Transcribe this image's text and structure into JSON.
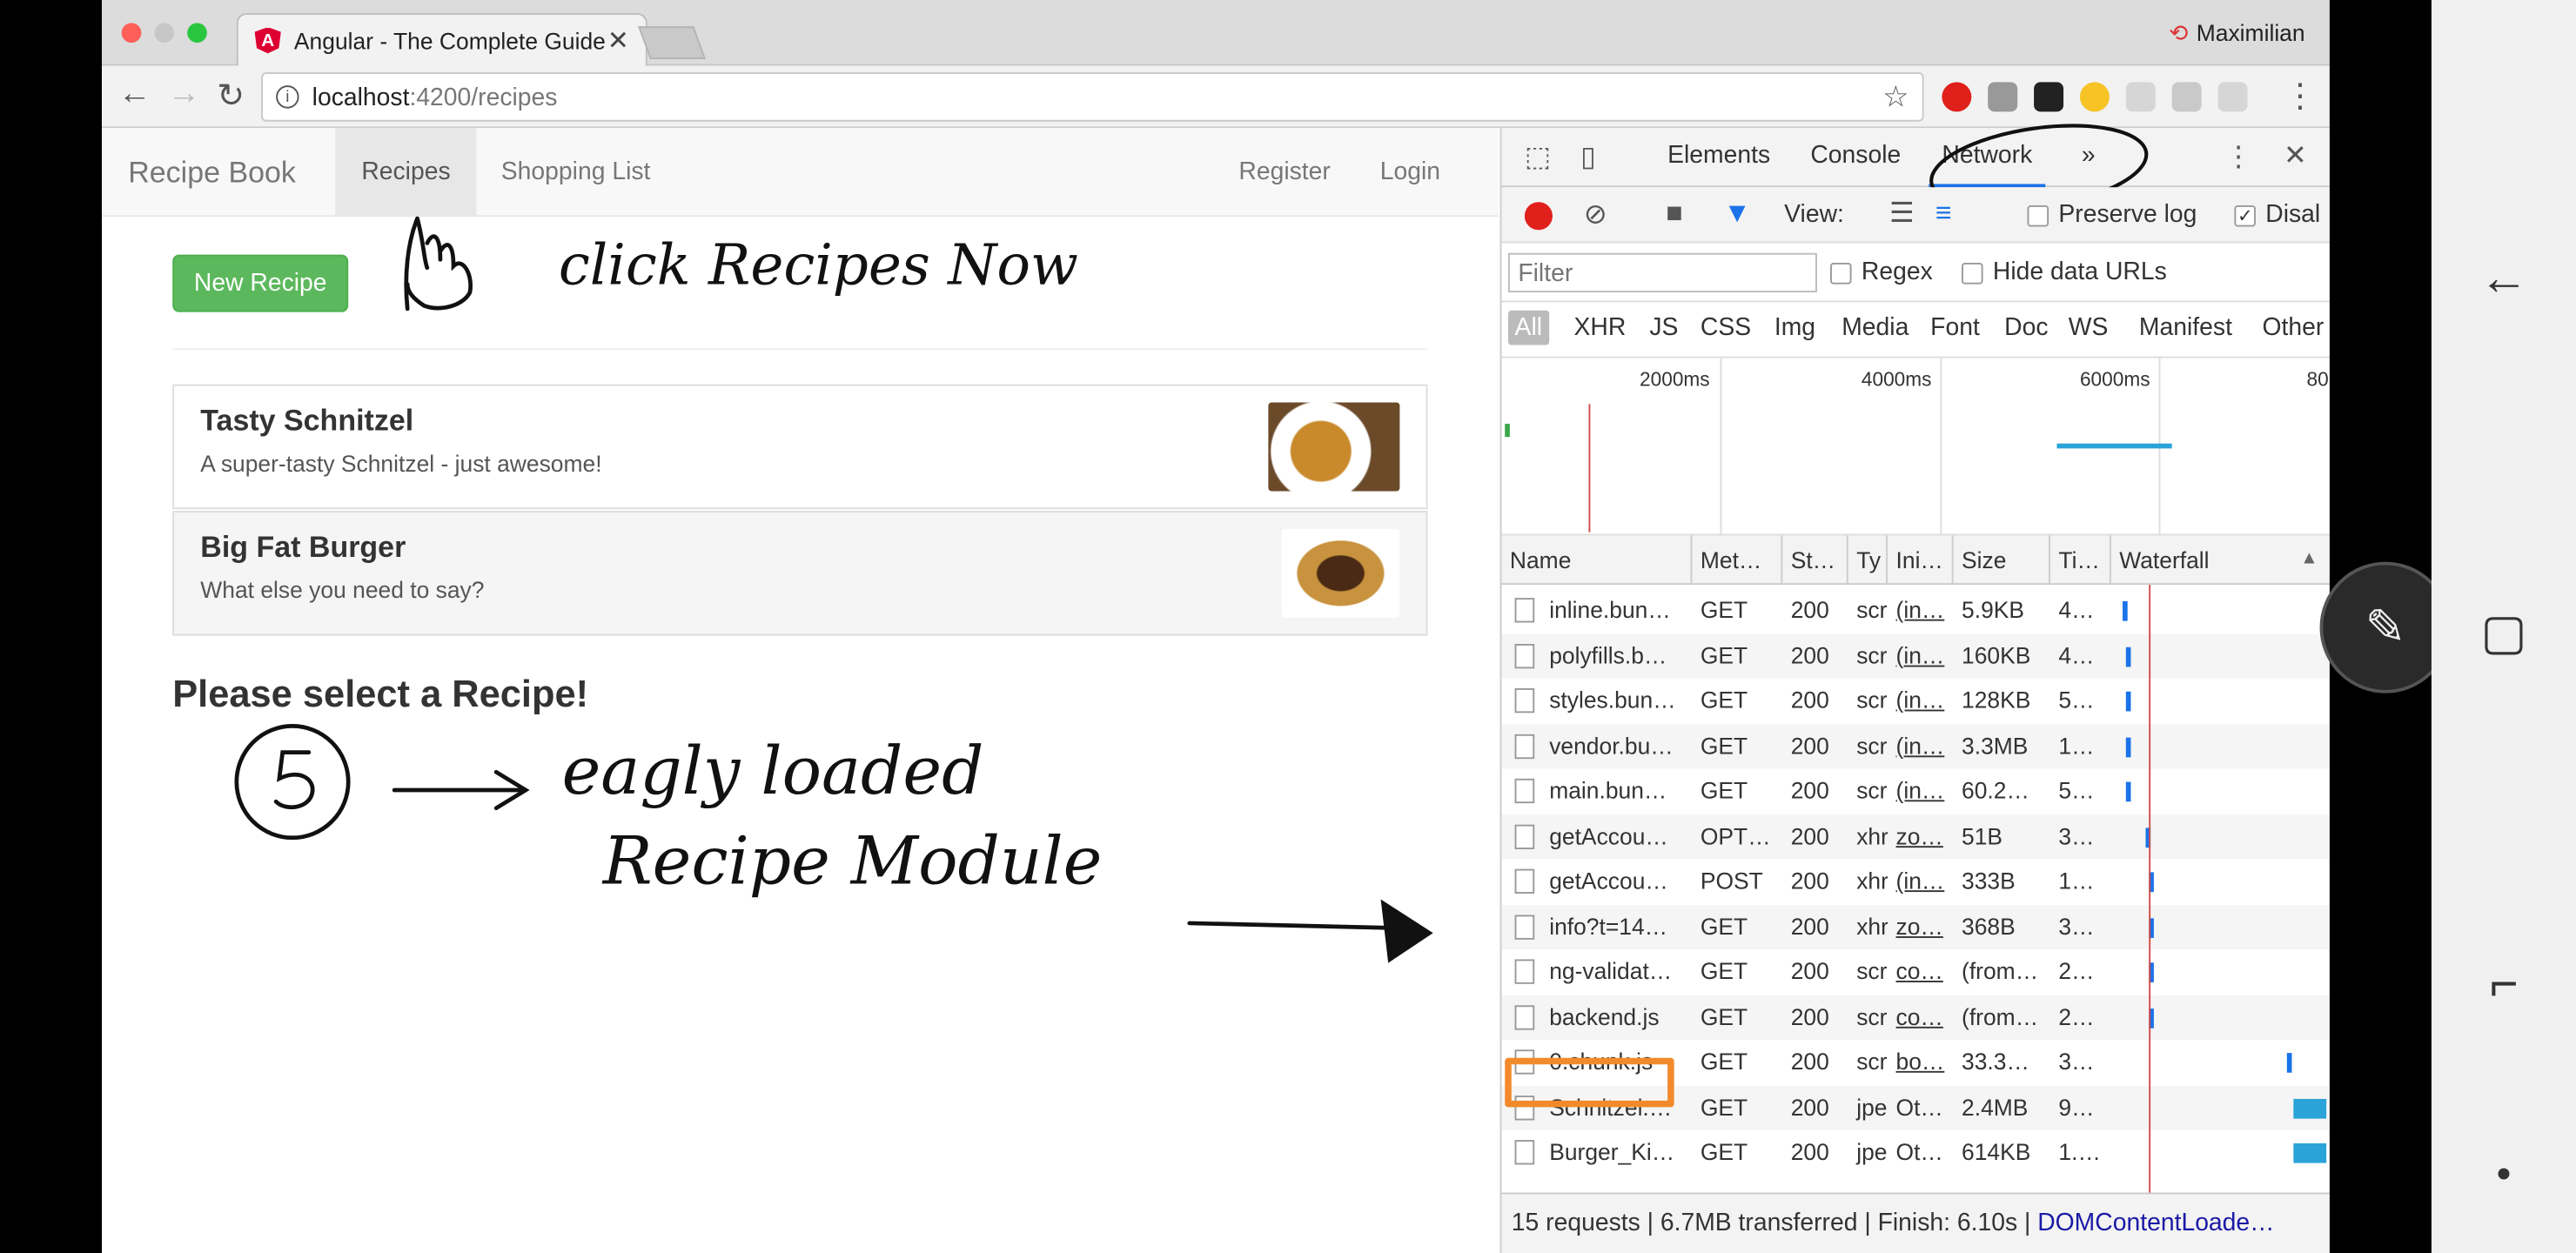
{
  "browser": {
    "tab_title": "Angular - The Complete Guide",
    "tab_close": "✕",
    "user_name": "Maximilian",
    "url_host": "localhost",
    "url_path": ":4200/recipes"
  },
  "app": {
    "brand": "Recipe Book",
    "nav": {
      "recipes": "Recipes",
      "shopping": "Shopping List",
      "register": "Register",
      "login": "Login"
    },
    "new_recipe": "New Recipe",
    "recipes": [
      {
        "name": "Tasty Schnitzel",
        "description": "A super-tasty Schnitzel - just awesome!"
      },
      {
        "name": "Big Fat Burger",
        "description": "What else you need to say?"
      }
    ],
    "select_prompt": "Please select a Recipe!"
  },
  "annotations": {
    "note1": "click Recipes Now",
    "number": "5",
    "note2": "eagly loaded",
    "note3": "Recipe Module"
  },
  "devtools": {
    "tabs": {
      "elements": "Elements",
      "console": "Console",
      "network": "Network",
      "more": "»"
    },
    "view_label": "View:",
    "preserve_log": "Preserve log",
    "disable_cache": "Disal",
    "filter_placeholder": "Filter",
    "regex": "Regex",
    "hide_data_urls": "Hide data URLs",
    "types": [
      "All",
      "XHR",
      "JS",
      "CSS",
      "Img",
      "Media",
      "Font",
      "Doc",
      "WS",
      "Manifest",
      "Other"
    ],
    "timeline_ticks": [
      "2000ms",
      "4000ms",
      "6000ms",
      "80"
    ],
    "columns": [
      "Name",
      "Met…",
      "St…",
      "Ty",
      "Ini…",
      "Size",
      "Ti…",
      "Waterfall"
    ],
    "rows": [
      {
        "name": "inline.bun…",
        "method": "GET",
        "status": "200",
        "type": "scr",
        "initiator": "(in…",
        "size": "5.9KB",
        "time": "4…"
      },
      {
        "name": "polyfills.b…",
        "method": "GET",
        "status": "200",
        "type": "scr",
        "initiator": "(in…",
        "size": "160KB",
        "time": "4…"
      },
      {
        "name": "styles.bun…",
        "method": "GET",
        "status": "200",
        "type": "scr",
        "initiator": "(in…",
        "size": "128KB",
        "time": "5…"
      },
      {
        "name": "vendor.bu…",
        "method": "GET",
        "status": "200",
        "type": "scr",
        "initiator": "(in…",
        "size": "3.3MB",
        "time": "1…"
      },
      {
        "name": "main.bun…",
        "method": "GET",
        "status": "200",
        "type": "scr",
        "initiator": "(in…",
        "size": "60.2…",
        "time": "5…"
      },
      {
        "name": "getAccou…",
        "method": "OPT…",
        "status": "200",
        "type": "xhr",
        "initiator": "zo…",
        "size": "51B",
        "time": "3…"
      },
      {
        "name": "getAccou…",
        "method": "POST",
        "status": "200",
        "type": "xhr",
        "initiator": "(in…",
        "size": "333B",
        "time": "1…"
      },
      {
        "name": "info?t=14…",
        "method": "GET",
        "status": "200",
        "type": "xhr",
        "initiator": "zo…",
        "size": "368B",
        "time": "3…"
      },
      {
        "name": "ng-validat…",
        "method": "GET",
        "status": "200",
        "type": "scr",
        "initiator": "co…",
        "size": "(from…",
        "time": "2…"
      },
      {
        "name": "backend.js",
        "method": "GET",
        "status": "200",
        "type": "scr",
        "initiator": "co…",
        "size": "(from…",
        "time": "2…"
      },
      {
        "name": "0.chunk.js",
        "method": "GET",
        "status": "200",
        "type": "scr",
        "initiator": "bo…",
        "size": "33.3…",
        "time": "3…"
      },
      {
        "name": "Schnitzel.…",
        "method": "GET",
        "status": "200",
        "type": "jpe",
        "initiator": "Ot…",
        "size": "2.4MB",
        "time": "9…"
      },
      {
        "name": "Burger_Ki…",
        "method": "GET",
        "status": "200",
        "type": "jpe",
        "initiator": "Ot…",
        "size": "614KB",
        "time": "1.…"
      }
    ],
    "status_bar": "15 requests | 6.7MB transferred | Finish: 6.10s | ",
    "status_dcl": "DOMContentLoade…"
  },
  "colors": {
    "accent_blue": "#1a73e8",
    "green_button": "#5cb85c",
    "highlight_orange": "#f28a2c"
  }
}
